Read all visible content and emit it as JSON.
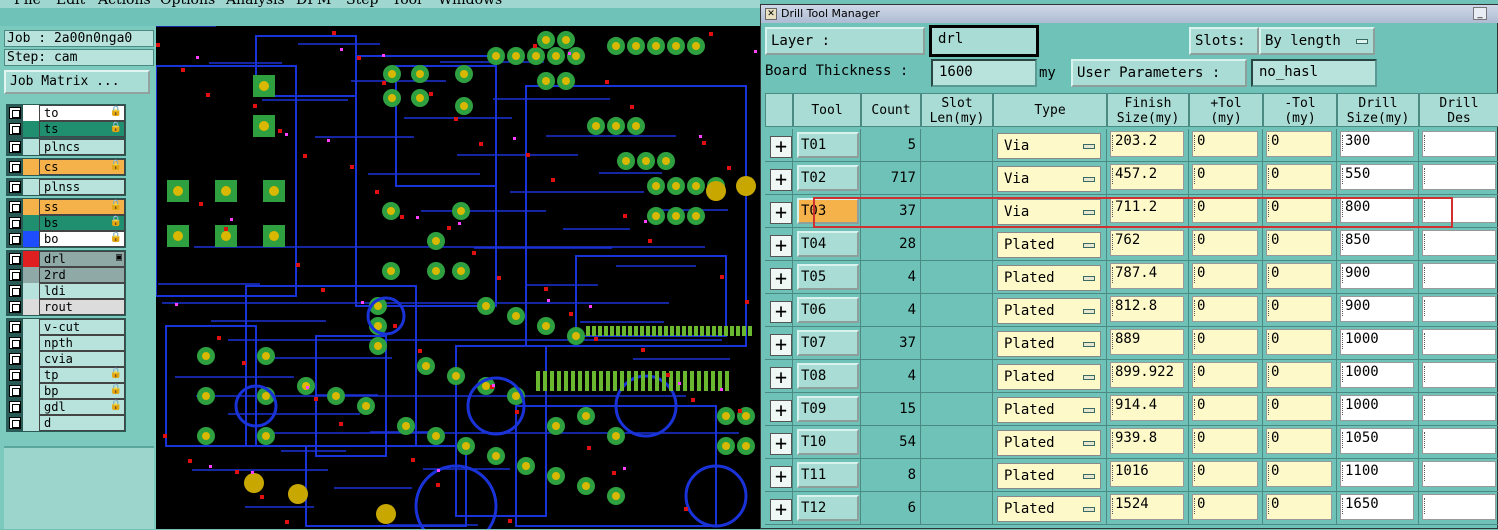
{
  "menu": [
    "File",
    "Edit",
    "Actions",
    "Options",
    "Analysis",
    "DFM",
    "Step",
    "Tool",
    "Windows"
  ],
  "job": {
    "job_label": "Job : 2a00n0nga0",
    "step_label": "Step: cam",
    "matrix_button": "Job Matrix ..."
  },
  "layers": [
    {
      "name": "to",
      "color": "#ffffff",
      "bg": "#ffffff",
      "mark": "🔒",
      "group": 0
    },
    {
      "name": "ts",
      "color": "#1f8f6f",
      "bg": "#1f8f6f",
      "mark": "🔒",
      "group": 0
    },
    {
      "name": "plncs",
      "color": "#b7e3dc",
      "bg": "#b7e3dc",
      "mark": "",
      "group": 1
    },
    {
      "name": "cs",
      "color": "#f6b24a",
      "bg": "#f6b24a",
      "mark": "🔒",
      "group": 2
    },
    {
      "name": "plnss",
      "color": "#b7e3dc",
      "bg": "#b7e3dc",
      "mark": "",
      "group": 3
    },
    {
      "name": "ss",
      "color": "#f6b24a",
      "bg": "#f6b24a",
      "mark": "🔒",
      "group": 4
    },
    {
      "name": "bs",
      "color": "#1f8f6f",
      "bg": "#1f8f6f",
      "mark": "🔒",
      "group": 4
    },
    {
      "name": "bo",
      "color": "#1e4cff",
      "bg": "#ffffff",
      "mark": "🔒",
      "group": 4
    },
    {
      "name": "drl",
      "color": "#e02020",
      "bg": "#8fa9a6",
      "mark": "▣",
      "group": 5
    },
    {
      "name": "2rd",
      "color": "#8fa9a6",
      "bg": "#8fa9a6",
      "mark": "",
      "group": 5
    },
    {
      "name": "ldi",
      "color": "#b7e3dc",
      "bg": "#b7e3dc",
      "mark": "",
      "group": 5
    },
    {
      "name": "rout",
      "color": "#dcdcdc",
      "bg": "#dcdcdc",
      "mark": "",
      "group": 5
    },
    {
      "name": "v-cut",
      "color": "#b7e3dc",
      "bg": "#b7e3dc",
      "mark": "",
      "group": 6
    },
    {
      "name": "npth",
      "color": "#b7e3dc",
      "bg": "#b7e3dc",
      "mark": "",
      "group": 6
    },
    {
      "name": "cvia",
      "color": "#b7e3dc",
      "bg": "#b7e3dc",
      "mark": "",
      "group": 6
    },
    {
      "name": "tp",
      "color": "#b7e3dc",
      "bg": "#b7e3dc",
      "mark": "🔒",
      "group": 6
    },
    {
      "name": "bp",
      "color": "#b7e3dc",
      "bg": "#b7e3dc",
      "mark": "🔒",
      "group": 6
    },
    {
      "name": "gdl",
      "color": "#b7e3dc",
      "bg": "#b7e3dc",
      "mark": "🔒",
      "group": 6
    },
    {
      "name": "d",
      "color": "#b7e3dc",
      "bg": "#b7e3dc",
      "mark": "",
      "group": 6
    }
  ],
  "dtm": {
    "title": "Drill Tool Manager",
    "layer_label": "Layer          :",
    "layer_value": "drl",
    "slots_label": "Slots:",
    "slots_value": "By length",
    "thickness_label": "Board Thickness :",
    "thickness_value": "1600",
    "thickness_unit": "my",
    "user_params_label": "User Parameters :",
    "user_params_value": "no_hasl",
    "columns": [
      {
        "l1": "Tool",
        "l2": ""
      },
      {
        "l1": "Count",
        "l2": ""
      },
      {
        "l1": "Slot",
        "l2": "Len(my)"
      },
      {
        "l1": "Type",
        "l2": ""
      },
      {
        "l1": "Finish",
        "l2": "Size(my)"
      },
      {
        "l1": "+Tol",
        "l2": "(my)"
      },
      {
        "l1": "-Tol",
        "l2": "(my)"
      },
      {
        "l1": "Drill",
        "l2": "Size(my)"
      },
      {
        "l1": "Drill",
        "l2": "Des"
      }
    ],
    "rows": [
      {
        "tool": "T01",
        "count": "5",
        "type": "Via",
        "finish": "203.2",
        "ptol": "0",
        "mtol": "0",
        "drill": "300",
        "sel": false
      },
      {
        "tool": "T02",
        "count": "717",
        "type": "Via",
        "finish": "457.2",
        "ptol": "0",
        "mtol": "0",
        "drill": "550",
        "sel": false
      },
      {
        "tool": "T03",
        "count": "37",
        "type": "Via",
        "finish": "711.2",
        "ptol": "0",
        "mtol": "0",
        "drill": "800",
        "sel": true
      },
      {
        "tool": "T04",
        "count": "28",
        "type": "Plated",
        "finish": "762",
        "ptol": "0",
        "mtol": "0",
        "drill": "850",
        "sel": false
      },
      {
        "tool": "T05",
        "count": "4",
        "type": "Plated",
        "finish": "787.4",
        "ptol": "0",
        "mtol": "0",
        "drill": "900",
        "sel": false
      },
      {
        "tool": "T06",
        "count": "4",
        "type": "Plated",
        "finish": "812.8",
        "ptol": "0",
        "mtol": "0",
        "drill": "900",
        "sel": false
      },
      {
        "tool": "T07",
        "count": "37",
        "type": "Plated",
        "finish": "889",
        "ptol": "0",
        "mtol": "0",
        "drill": "1000",
        "sel": false
      },
      {
        "tool": "T08",
        "count": "4",
        "type": "Plated",
        "finish": "899.922",
        "ptol": "0",
        "mtol": "0",
        "drill": "1000",
        "sel": false
      },
      {
        "tool": "T09",
        "count": "15",
        "type": "Plated",
        "finish": "914.4",
        "ptol": "0",
        "mtol": "0",
        "drill": "1000",
        "sel": false
      },
      {
        "tool": "T10",
        "count": "54",
        "type": "Plated",
        "finish": "939.8",
        "ptol": "0",
        "mtol": "0",
        "drill": "1050",
        "sel": false
      },
      {
        "tool": "T11",
        "count": "8",
        "type": "Plated",
        "finish": "1016",
        "ptol": "0",
        "mtol": "0",
        "drill": "1100",
        "sel": false
      },
      {
        "tool": "T12",
        "count": "6",
        "type": "Plated",
        "finish": "1524",
        "ptol": "0",
        "mtol": "0",
        "drill": "1650",
        "sel": false
      }
    ]
  }
}
